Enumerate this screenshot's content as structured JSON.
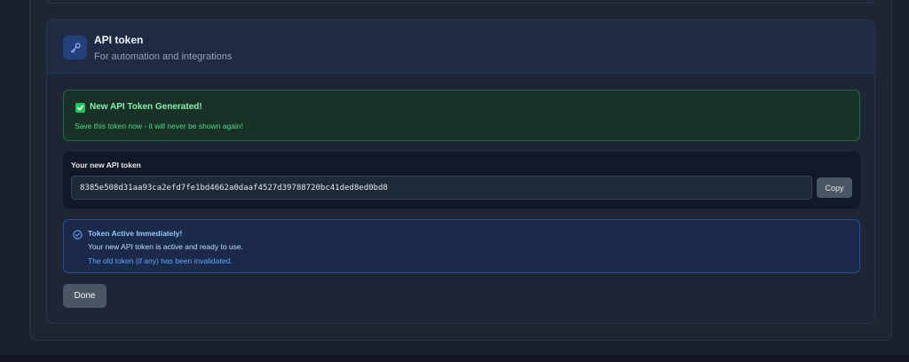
{
  "card": {
    "title": "API token",
    "subtitle": "For automation and integrations",
    "icon": "key-icon"
  },
  "success_alert": {
    "icon": "check-icon",
    "title": "New API Token Generated!",
    "message": "Save this token now - it will never be shown again!"
  },
  "token": {
    "label": "Your new API token",
    "value": "8385e508d31aa93ca2efd7fe1bd4662a0daaf4527d39788720bc41ded8ed0bd8",
    "copy_label": "Copy"
  },
  "info_alert": {
    "icon": "check-circle-icon",
    "title": "Token Active Immediately!",
    "line1": "Your new API token is active and ready to use.",
    "line2": "The old token (if any) has been invalidated."
  },
  "actions": {
    "done_label": "Done"
  },
  "colors": {
    "success": "#22c55e",
    "info": "#3b82f6",
    "accent": "#23407a"
  }
}
